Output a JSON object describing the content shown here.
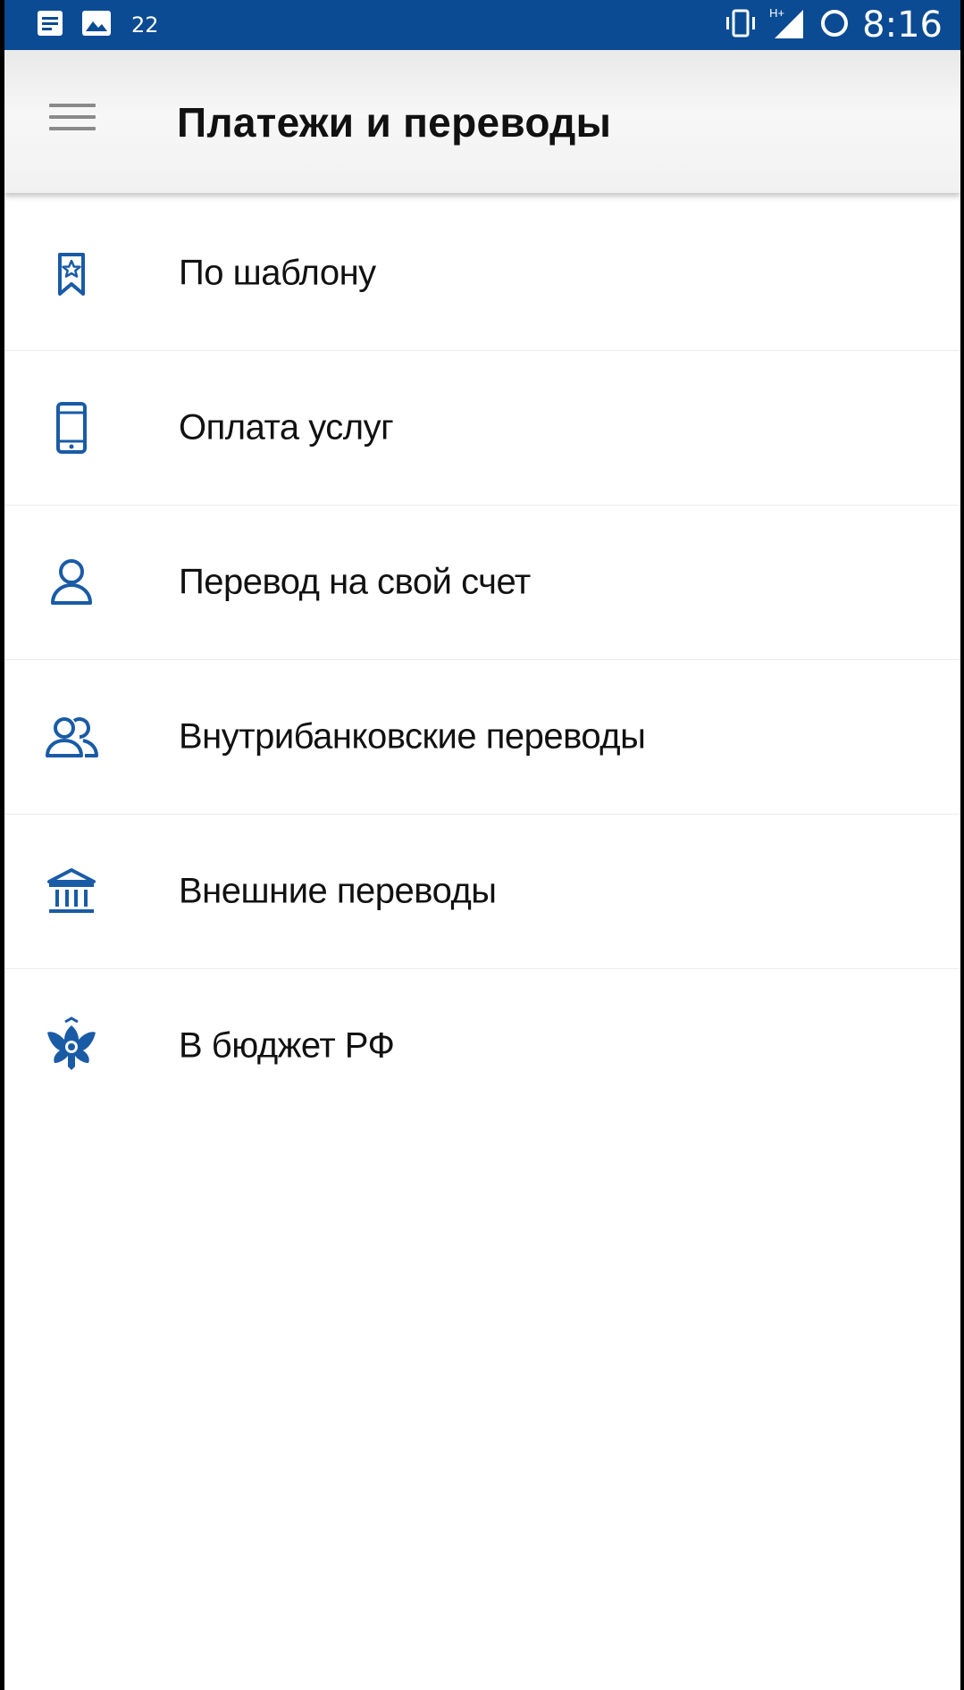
{
  "status_bar": {
    "temperature": "22",
    "time": "8:16",
    "network": "H+",
    "icons": [
      "notes-icon",
      "image-icon",
      "vibrate-icon",
      "signal-icon",
      "battery-ring-icon"
    ]
  },
  "app_bar": {
    "title": "Платежи и переводы",
    "menu_icon": "hamburger-icon"
  },
  "menu": {
    "items": [
      {
        "label": "По шаблону",
        "icon": "bookmark-star-icon"
      },
      {
        "label": "Оплата услуг",
        "icon": "smartphone-icon"
      },
      {
        "label": "Перевод на свой счет",
        "icon": "user-icon"
      },
      {
        "label": "Внутрибанковские переводы",
        "icon": "users-icon"
      },
      {
        "label": "Внешние переводы",
        "icon": "bank-icon"
      },
      {
        "label": "В бюджет РФ",
        "icon": "coat-of-arms-icon"
      }
    ]
  },
  "colors": {
    "status_bar": "#0a4b93",
    "icon_blue": "#1a5ba6",
    "app_bar": "#f2f2f2",
    "text": "#111111"
  }
}
